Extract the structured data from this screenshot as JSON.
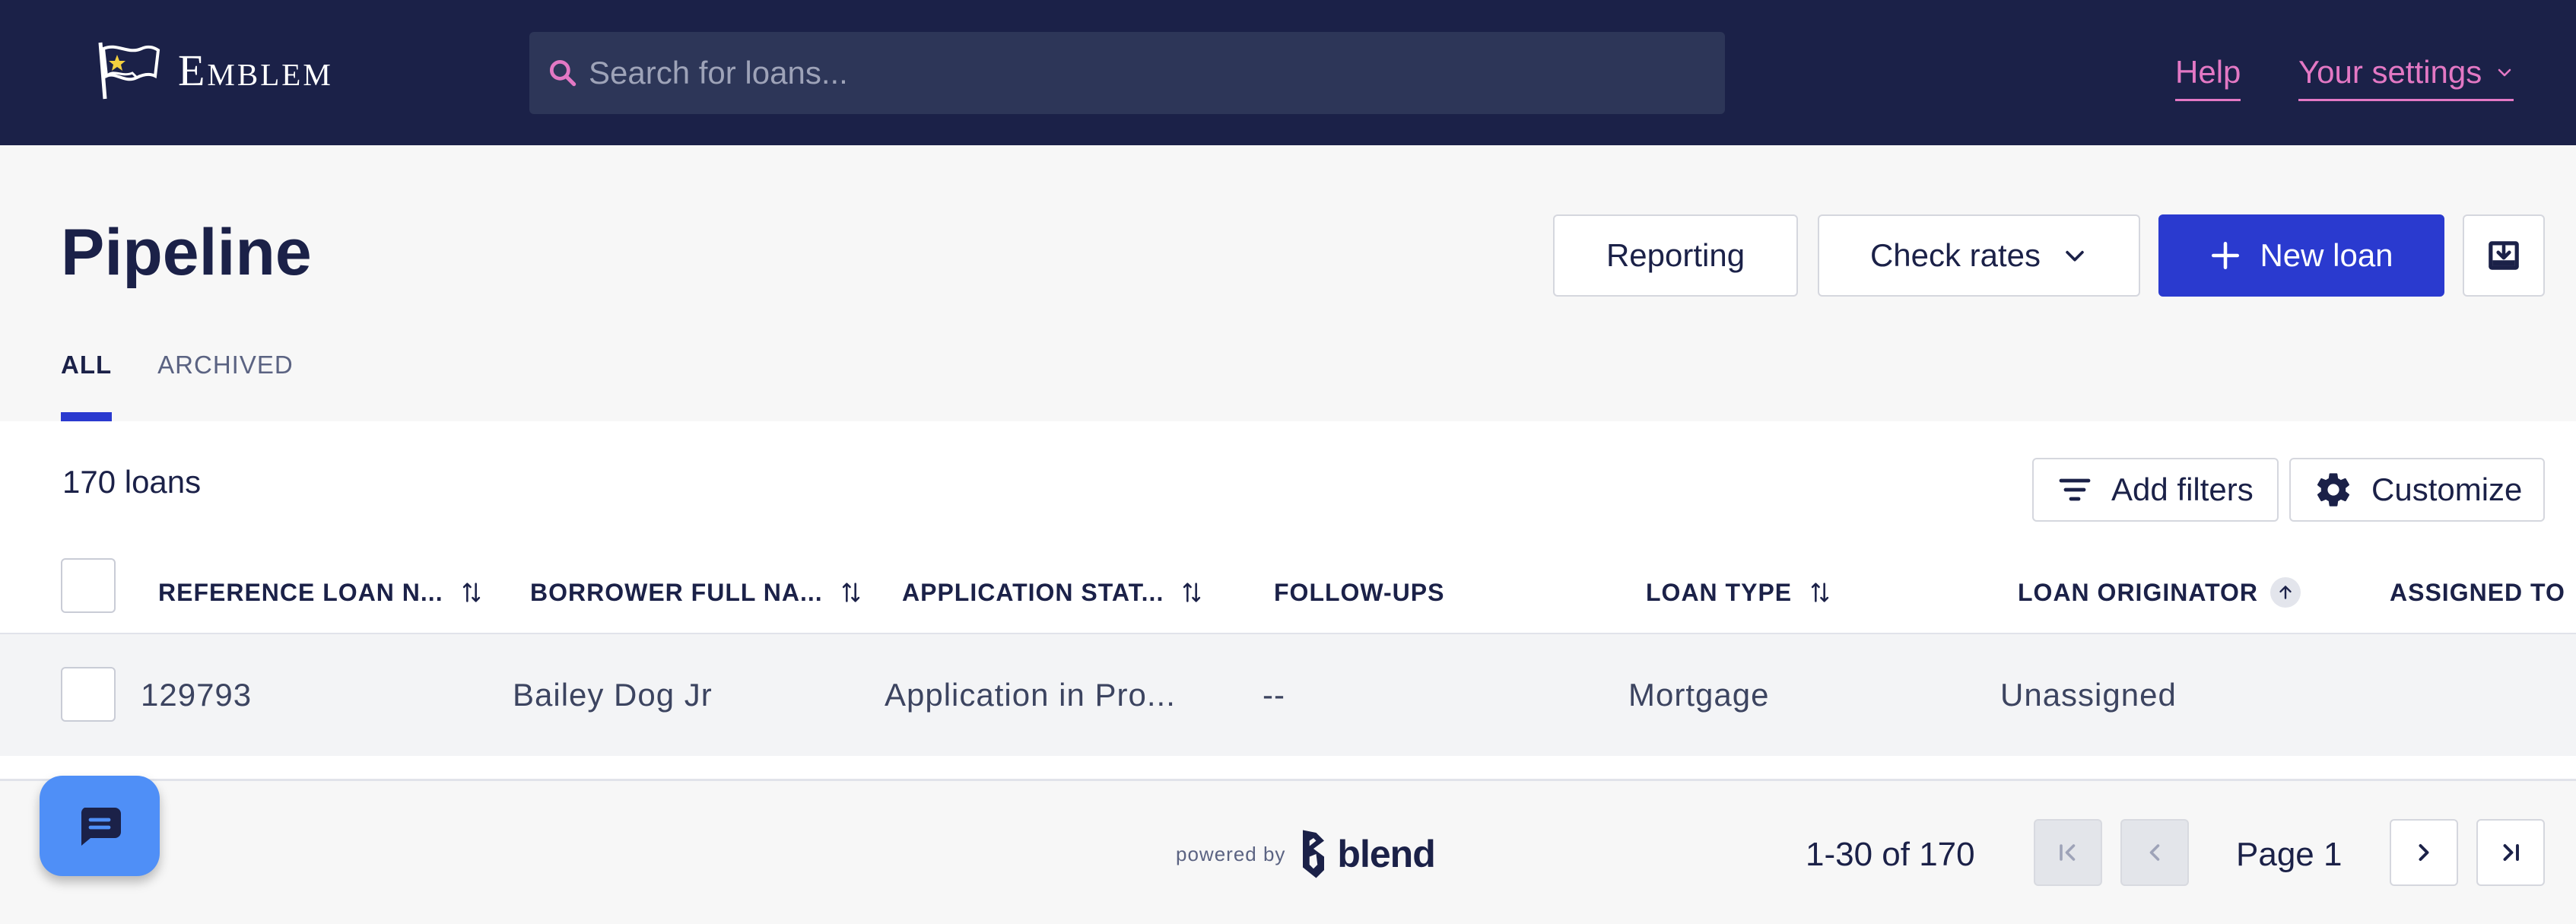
{
  "brand": {
    "name": "Emblem"
  },
  "topnav": {
    "search_placeholder": "Search for loans...",
    "help": "Help",
    "settings": "Your settings"
  },
  "header": {
    "title": "Pipeline",
    "reporting": "Reporting",
    "check_rates": "Check rates",
    "new_loan": "New loan"
  },
  "tabs": [
    "ALL",
    "ARCHIVED"
  ],
  "toolbar": {
    "loan_count": "170 loans",
    "add_filters": "Add filters",
    "customize": "Customize"
  },
  "table": {
    "columns": [
      "REFERENCE LOAN N...",
      "BORROWER FULL NA...",
      "APPLICATION STAT...",
      "FOLLOW-UPS",
      "LOAN TYPE",
      "LOAN ORIGINATOR",
      "ASSIGNED TO"
    ],
    "rows": [
      [
        "129793",
        "Bailey Dog Jr",
        "Application in Pro...",
        "--",
        "Mortgage",
        "Unassigned"
      ]
    ]
  },
  "footer": {
    "powered_by": "powered by",
    "blend": "blend",
    "range": "1-30 of 170",
    "page": "Page 1"
  },
  "colors": {
    "nav_bg": "#1b2148",
    "accent": "#2a3acf",
    "link_pink": "#e378c4",
    "chat_blue": "#4f8ff7"
  },
  "icons": [
    "flag-logo-icon",
    "search-icon",
    "chevron-down-icon",
    "plus-icon",
    "download-icon",
    "filter-icon",
    "gear-icon",
    "sort-icon",
    "sort-asc-icon",
    "chat-icon",
    "blend-logo-icon",
    "first-page-icon",
    "prev-page-icon",
    "next-page-icon",
    "last-page-icon"
  ]
}
